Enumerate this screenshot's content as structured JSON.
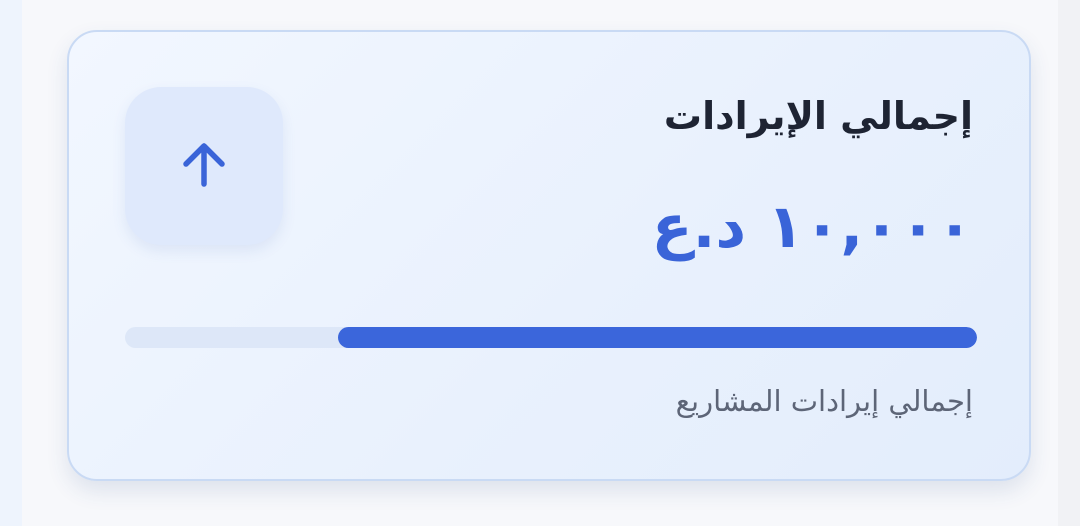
{
  "card": {
    "title": "إجمالي الإيرادات",
    "value": "١٠,٠٠٠ د.ع",
    "subtitle": "إجمالي إيرادات المشاريع",
    "icon": "arrow-up-icon",
    "progress_fraction": 0.75
  },
  "colors": {
    "accent": "#3b66db",
    "title": "#1e2433",
    "subtitle": "#5d6577",
    "track": "#dde7f8",
    "icon_bg": "#dfe9fc",
    "card_border": "#c9daf4"
  }
}
